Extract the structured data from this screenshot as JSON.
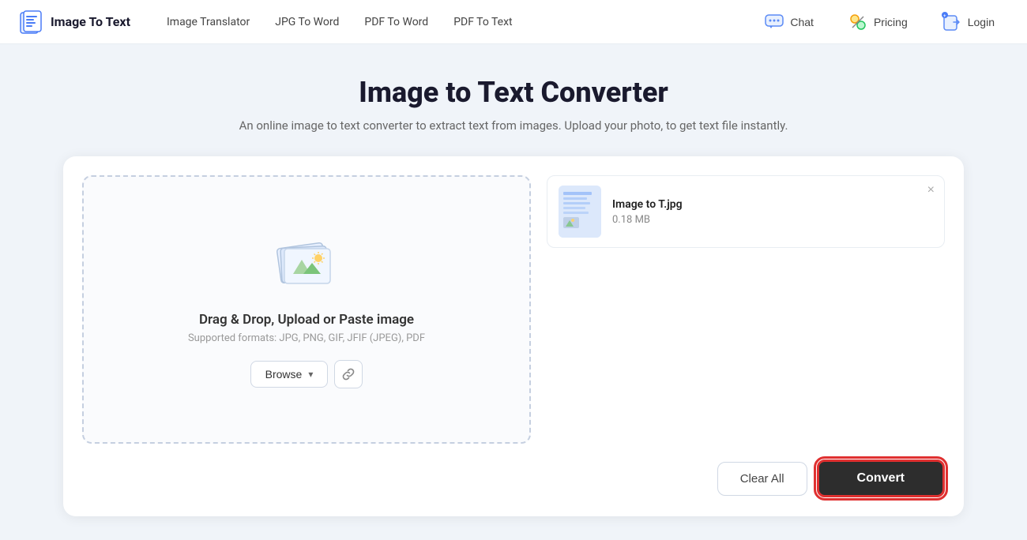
{
  "header": {
    "logo_text": "Image To Text",
    "nav_items": [
      {
        "label": "Image Translator",
        "id": "image-translator"
      },
      {
        "label": "JPG To Word",
        "id": "jpg-to-word"
      },
      {
        "label": "PDF To Word",
        "id": "pdf-to-word"
      },
      {
        "label": "PDF To Text",
        "id": "pdf-to-text"
      }
    ],
    "chat_label": "Chat",
    "pricing_label": "Pricing",
    "login_label": "Login"
  },
  "main": {
    "title": "Image to Text Converter",
    "subtitle": "An online image to text converter to extract text from images. Upload your photo, to get text file instantly.",
    "drop_zone": {
      "title": "Drag & Drop, Upload or Paste image",
      "subtitle": "Supported formats: JPG, PNG, GIF, JFIF (JPEG), PDF",
      "browse_label": "Browse",
      "chevron": "▾"
    },
    "file": {
      "name": "Image to T.jpg",
      "size": "0.18 MB"
    },
    "clear_all_label": "Clear All",
    "convert_label": "Convert"
  }
}
